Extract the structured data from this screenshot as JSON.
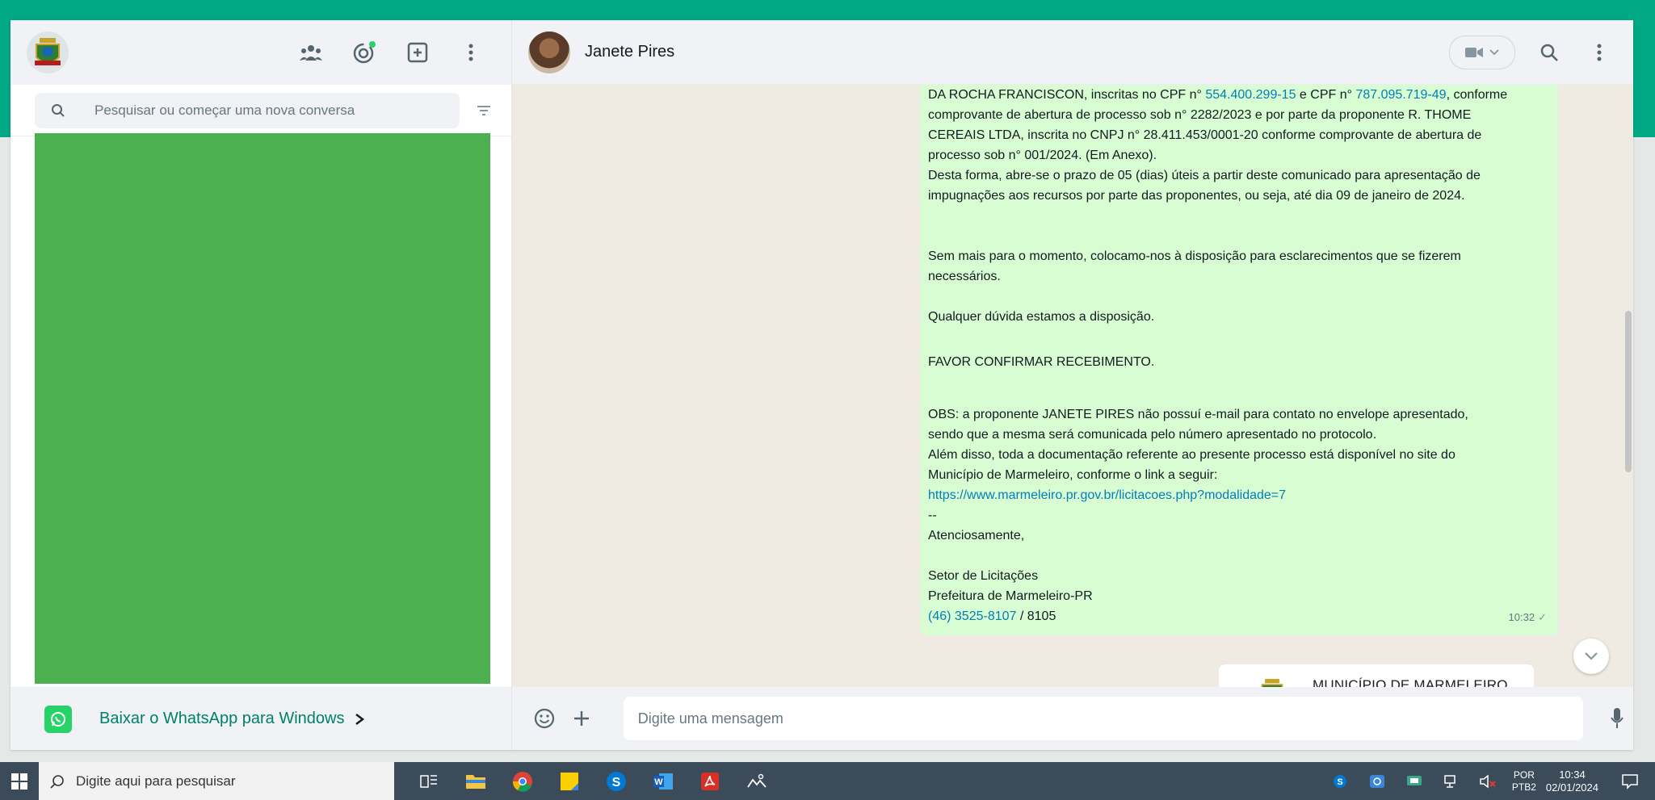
{
  "left_panel": {
    "search_placeholder": "Pesquisar ou começar uma nova conversa",
    "download_text": "Baixar o WhatsApp para Windows"
  },
  "chat": {
    "contact_name": "Janete Pires",
    "message": {
      "line1_prefix": "DA ROCHA FRANCISCON, inscritas no CPF n° ",
      "cpf1": "554.400.299-15",
      "line1_mid": " e CPF n° ",
      "cpf2": "787.095.719-49",
      "line1_suffix": ", conforme",
      "para1_rest": "comprovante de abertura de processo sob n° 2282/2023 e por parte da proponente R. THOME\nCEREAIS LTDA, inscrita no CNPJ n° 28.411.453/0001-20 conforme comprovante de abertura de\nprocesso sob n° 001/2024. (Em Anexo).\nDesta forma, abre-se o prazo de 05 (dias) úteis a partir deste comunicado para apresentação de\nimpugnações aos recursos por parte das proponentes, ou seja, até dia 09 de janeiro de 2024.",
      "para2": "Sem mais para o momento, colocamo-nos à disposição para esclarecimentos que se fizerem\nnecessários.",
      "para3": "Qualquer dúvida estamos a disposição.",
      "para4": "FAVOR CONFIRMAR RECEBIMENTO.",
      "para5": "OBS: a proponente JANETE PIRES não possuí e-mail para contato no envelope apresentado,\nsendo que a mesma será comunicada pelo número apresentado no protocolo.\nAlém disso, toda a documentação referente ao presente processo está disponível no site do\nMunicípio de Marmeleiro, conforme o link a seguir:",
      "link": "https://www.marmeleiro.pr.gov.br/licitacoes.php?modalidade=7",
      "sig_dash": "--",
      "sig_regards": "Atenciosamente,",
      "sig_dept": "Setor de Licitações",
      "sig_org": "Prefeitura de Marmeleiro-PR",
      "phone": "(46) 3525-8107",
      "phone_ext": " / 8105",
      "time": "10:32"
    },
    "image_preview_title": "MUNICÍPIO DE MARMELEIRO",
    "composer_placeholder": "Digite uma mensagem"
  },
  "taskbar": {
    "search_text": "Digite aqui para pesquisar",
    "lang": "POR",
    "lang_sub": "PTB2",
    "time": "10:34",
    "date": "02/01/2024"
  },
  "colors": {
    "whatsapp_green": "#00a884",
    "bubble_green": "#d9fdd3",
    "link_blue": "#027eb5",
    "chat_bg": "#efeae2",
    "taskbar": "#3b4b59"
  }
}
